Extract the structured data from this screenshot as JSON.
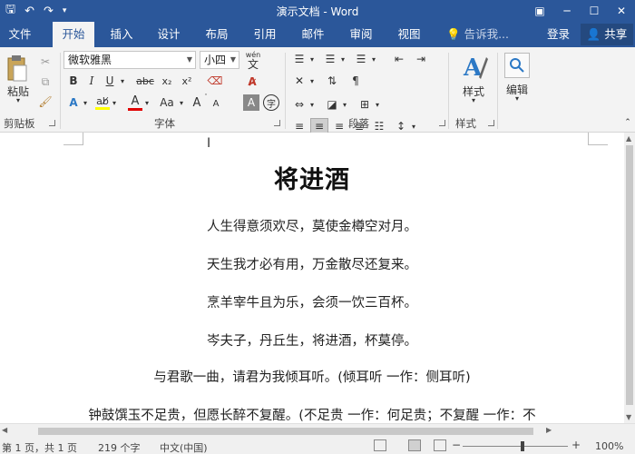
{
  "titlebar": {
    "title": "演示文档 - Word",
    "qat_save": "🖫",
    "qat_undo": "↶",
    "qat_redo": "↷",
    "qat_more": "▾",
    "ribbon_display": "▣",
    "minimize": "─",
    "maximize": "☐",
    "close": "✕"
  },
  "tabs": {
    "items": [
      {
        "label": "文件"
      },
      {
        "label": "开始"
      },
      {
        "label": "插入"
      },
      {
        "label": "设计"
      },
      {
        "label": "布局"
      },
      {
        "label": "引用"
      },
      {
        "label": "邮件"
      },
      {
        "label": "审阅"
      },
      {
        "label": "视图"
      }
    ],
    "tell_me": "告诉我...",
    "login": "登录",
    "share": "共享"
  },
  "ribbon": {
    "clipboard": {
      "label": "剪贴板",
      "paste": "粘贴"
    },
    "font": {
      "label": "字体",
      "font_name": "微软雅黑",
      "font_size": "小四",
      "wen": "wén",
      "wen_char": "文",
      "bold": "B",
      "italic": "I",
      "underline": "U",
      "strike": "abc",
      "sub": "x₂",
      "sup": "x²",
      "text_effect": "A",
      "font_color": "A",
      "change_case": "Aa",
      "grow": "A",
      "shrink": "A",
      "char_shade": "A",
      "enclosed": "字"
    },
    "paragraph": {
      "label": "段落"
    },
    "styles": {
      "label": "样式",
      "btn": "样式"
    },
    "editing": {
      "btn": "编辑"
    },
    "colors": {
      "highlight": "#ffff00",
      "font_color_bar": "#e00000"
    }
  },
  "document": {
    "title": "将进酒",
    "lines": [
      "人生得意须欢尽，莫使金樽空对月。",
      "天生我才必有用，万金散尽还复来。",
      "烹羊宰牛且为乐，会须一饮三百杯。",
      "岑夫子，丹丘生，将进酒，杯莫停。",
      "与君歌一曲，请君为我倾耳听。(倾耳听  一作：侧耳听)",
      "钟鼓馔玉不足贵，但愿长醉不复醒。(不足贵  一作：何足贵；不复醒  一作：不"
    ]
  },
  "status": {
    "page": "第 1 页，共 1 页",
    "words": "219 个字",
    "language": "中文(中国)",
    "zoom": "100%"
  }
}
